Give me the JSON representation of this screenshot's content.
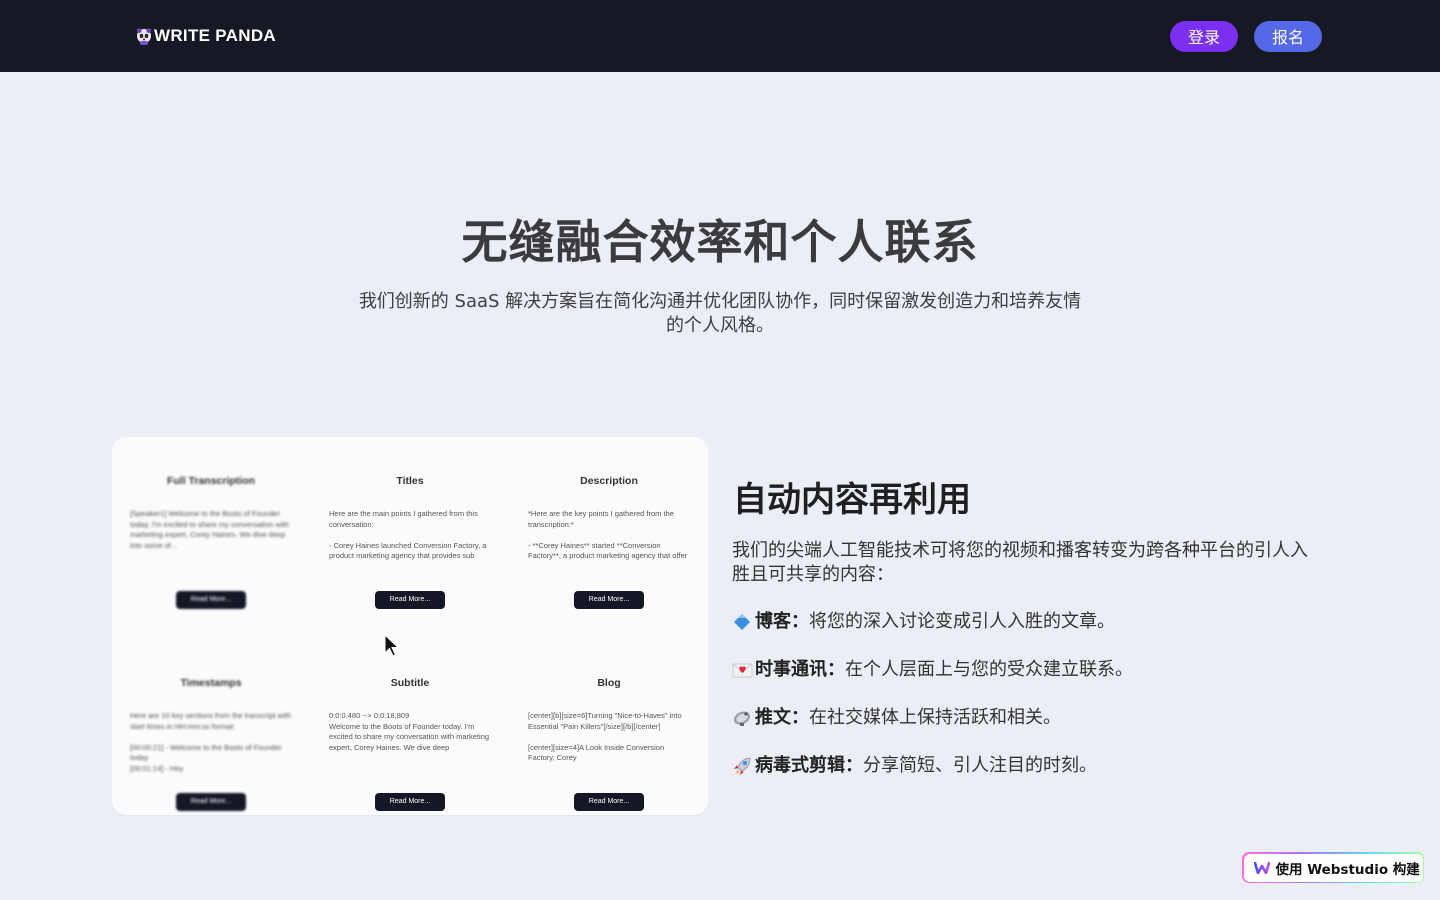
{
  "header": {
    "logo_text": "WRITE PANDA",
    "login_label": "登录",
    "signup_label": "报名"
  },
  "hero": {
    "title": "无缝融合效率和个人联系",
    "subtitle": "我们创新的 SaaS 解决方案旨在简化沟通并优化团队协作，同时保留激发创造力和培养友情的个人风格。"
  },
  "preview": {
    "cells": [
      {
        "title": "Full Transcription",
        "body": "[Speaker1] Welcome to the Boots of Founder today. I'm excited to share my conversation with marketing expert, Corey Haines. We dive deep into some of...",
        "button": "Read More..."
      },
      {
        "title": "Titles",
        "body": "Here are the main points I gathered from this conversation:\n\n- Corey Haines launched Conversion Factory, a product marketing agency that provides sub",
        "button": "Read More..."
      },
      {
        "title": "Description",
        "body": "*Here are the key points I gathered from the transcription:*\n\n- **Corey Haines** started **Conversion Factory**, a product marketing agency that offer",
        "button": "Read More..."
      },
      {
        "title": "Timestamps",
        "body": "Here are 10 key sections from the transcript with start times in HH:mm:ss format:\n\n[00:00:21] - Welcome to the Boots of Founder today\n[00:01:14] - Hey",
        "button": "Read More..."
      },
      {
        "title": "Subtitle",
        "body": "0:0:0.480 --> 0:0:18,809\nWelcome to the Boots of Founder today. I'm excited to share my conversation with marketing expert, Corey Haines. We dive deep",
        "button": "Read More..."
      },
      {
        "title": "Blog",
        "body": "[center][b][size=6]Turning \"Nice-to-Haves\" into Essential \"Pain Killers\"[/size][/b][/center]\n\n[center][size=4]A Look Inside Conversion Factory, Corey",
        "button": "Read More..."
      }
    ]
  },
  "feature": {
    "title": "自动内容再利用",
    "description": "我们的尖端人工智能技术可将您的视频和播客转变为跨各种平台的引人入胜且可共享的内容：",
    "items": [
      {
        "icon": "blue-diamond-icon",
        "label": "博客",
        "text": "将您的深入讨论变成引人入胜的文章。"
      },
      {
        "icon": "love-letter-icon",
        "label": "时事通讯",
        "text": "在个人层面上与您的受众建立联系。"
      },
      {
        "icon": "satellite-dish-icon",
        "label": "推文",
        "text": "在社交媒体上保持活跃和相关。"
      },
      {
        "icon": "rocket-icon",
        "label": "病毒式剪辑",
        "text": "分享简短、引人注目的时刻。"
      }
    ],
    "separator": "："
  },
  "badge": {
    "label": "使用 Webstudio 构建"
  },
  "colors": {
    "header_bg": "#161823",
    "login": "#7b2ff0",
    "signup": "#5468e8",
    "page_bg": "#eceef6"
  }
}
